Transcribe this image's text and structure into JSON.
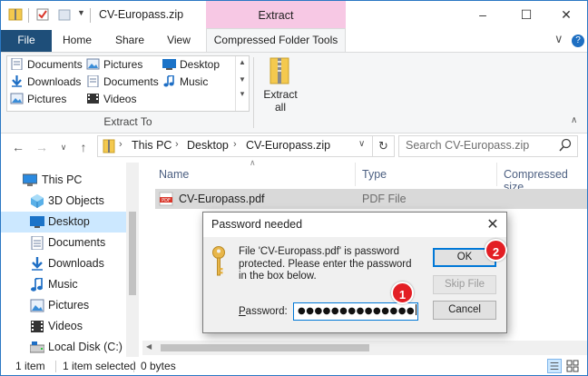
{
  "window": {
    "title": "CV-Europass.zip",
    "contextual_tab": "Extract",
    "controls": {
      "minimize": "–",
      "maximize": "☐",
      "close": "✕"
    }
  },
  "ribbon_tabs": {
    "file": "File",
    "items": [
      "Home",
      "Share",
      "View"
    ],
    "active": "Compressed Folder Tools",
    "collapse_icon": "∨",
    "help_icon": "?"
  },
  "ribbon": {
    "gallery_items": [
      {
        "label": "Documents",
        "icon": "documents-icon"
      },
      {
        "label": "Pictures",
        "icon": "pictures-icon"
      },
      {
        "label": "Desktop",
        "icon": "desktop-icon"
      },
      {
        "label": "Downloads",
        "icon": "downloads-icon"
      },
      {
        "label": "Documents",
        "icon": "documents-icon"
      },
      {
        "label": "Music",
        "icon": "music-icon"
      },
      {
        "label": "Pictures",
        "icon": "pictures-icon"
      },
      {
        "label": "Videos",
        "icon": "videos-icon"
      }
    ],
    "group_label": "Extract To",
    "extract_all_line1": "Extract",
    "extract_all_line2": "all"
  },
  "address": {
    "crumbs": [
      "This PC",
      "Desktop",
      "CV-Europass.zip"
    ],
    "search_placeholder": "Search CV-Europass.zip"
  },
  "nav": {
    "items": [
      {
        "label": "This PC",
        "icon": "this-pc-icon"
      },
      {
        "label": "3D Objects",
        "icon": "3d-objects-icon"
      },
      {
        "label": "Desktop",
        "icon": "desktop-icon",
        "selected": true
      },
      {
        "label": "Documents",
        "icon": "documents-icon"
      },
      {
        "label": "Downloads",
        "icon": "downloads-icon"
      },
      {
        "label": "Music",
        "icon": "music-icon"
      },
      {
        "label": "Pictures",
        "icon": "pictures-icon"
      },
      {
        "label": "Videos",
        "icon": "videos-icon"
      },
      {
        "label": "Local Disk (C:)",
        "icon": "local-disk-icon"
      }
    ]
  },
  "filelist": {
    "columns": [
      "Name",
      "Type",
      "Compressed size"
    ],
    "rows": [
      {
        "name": "CV-Europass.pdf",
        "type": "PDF File"
      }
    ]
  },
  "status": {
    "count": "1 item",
    "selected": "1 item selected",
    "size": "0 bytes"
  },
  "dialog": {
    "title": "Password needed",
    "message": "File 'CV-Europass.pdf' is password protected.  Please enter the password in the box below.",
    "password_label_prefix": "P",
    "password_label_rest": "assword:",
    "password_value": "●●●●●●●●●●●●●●",
    "ok": "OK",
    "skip": "Skip File",
    "cancel": "Cancel"
  },
  "annotations": {
    "badge1": "1",
    "badge2": "2"
  },
  "colors": {
    "file_tab": "#1e4e79",
    "contextual_tab": "#f7c8e4",
    "selection": "#cce8ff",
    "accent": "#0078d7",
    "badge": "#e31e24"
  }
}
